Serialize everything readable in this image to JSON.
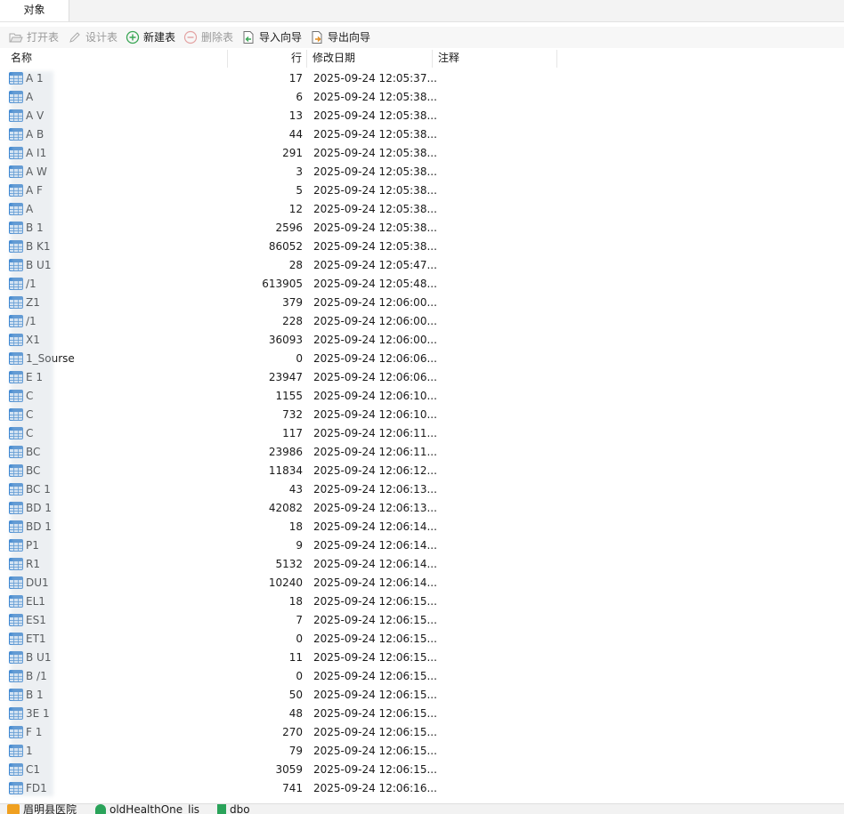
{
  "tabs": [
    {
      "label": "对象"
    }
  ],
  "toolbar": {
    "open_table": "打开表",
    "design_table": "设计表",
    "new_table": "新建表",
    "delete_table": "删除表",
    "import_wizard": "导入向导",
    "export_wizard": "导出向导"
  },
  "columns": {
    "name": "名称",
    "rows": "行",
    "modified": "修改日期",
    "comment": "注释"
  },
  "tables": [
    {
      "name": "A   1",
      "rows": "17",
      "modified": "2025-09-24 12:05:37..."
    },
    {
      "name": "A",
      "rows": "6",
      "modified": "2025-09-24 12:05:38..."
    },
    {
      "name": "A V",
      "rows": "13",
      "modified": "2025-09-24 12:05:38..."
    },
    {
      "name": "A B",
      "rows": "44",
      "modified": "2025-09-24 12:05:38..."
    },
    {
      "name": "A  I1",
      "rows": "291",
      "modified": "2025-09-24 12:05:38..."
    },
    {
      "name": "A W",
      "rows": "3",
      "modified": "2025-09-24 12:05:38..."
    },
    {
      "name": "A F",
      "rows": "5",
      "modified": "2025-09-24 12:05:38..."
    },
    {
      "name": "A",
      "rows": "12",
      "modified": "2025-09-24 12:05:38..."
    },
    {
      "name": "B   1",
      "rows": "2596",
      "modified": "2025-09-24 12:05:38..."
    },
    {
      "name": "B  K1",
      "rows": "86052",
      "modified": "2025-09-24 12:05:38..."
    },
    {
      "name": "B  U1",
      "rows": "28",
      "modified": "2025-09-24 12:05:47..."
    },
    {
      "name": "   /1",
      "rows": "613905",
      "modified": "2025-09-24 12:05:48..."
    },
    {
      "name": "   Z1",
      "rows": "379",
      "modified": "2025-09-24 12:06:00..."
    },
    {
      "name": "   /1",
      "rows": "228",
      "modified": "2025-09-24 12:06:00..."
    },
    {
      "name": "   X1",
      "rows": "36093",
      "modified": "2025-09-24 12:06:00..."
    },
    {
      "name": "    1_Sourse",
      "rows": "0",
      "modified": "2025-09-24 12:06:06..."
    },
    {
      "name": "  E 1",
      "rows": "23947",
      "modified": "2025-09-24 12:06:06..."
    },
    {
      "name": "  C",
      "rows": "1155",
      "modified": "2025-09-24 12:06:10..."
    },
    {
      "name": "  C",
      "rows": "732",
      "modified": "2025-09-24 12:06:10..."
    },
    {
      "name": "  C",
      "rows": "117",
      "modified": "2025-09-24 12:06:11..."
    },
    {
      "name": "  BC",
      "rows": "23986",
      "modified": "2025-09-24 12:06:11..."
    },
    {
      "name": "  BC",
      "rows": "11834",
      "modified": "2025-09-24 12:06:12..."
    },
    {
      "name": "  BC 1",
      "rows": "43",
      "modified": "2025-09-24 12:06:13..."
    },
    {
      "name": "  BD  1",
      "rows": "42082",
      "modified": "2025-09-24 12:06:13..."
    },
    {
      "name": "  BD  1",
      "rows": "18",
      "modified": "2025-09-24 12:06:14..."
    },
    {
      "name": "    P1",
      "rows": "9",
      "modified": "2025-09-24 12:06:14..."
    },
    {
      "name": "    R1",
      "rows": "5132",
      "modified": "2025-09-24 12:06:14..."
    },
    {
      "name": "   DU1",
      "rows": "10240",
      "modified": "2025-09-24 12:06:14..."
    },
    {
      "name": "   EL1",
      "rows": "18",
      "modified": "2025-09-24 12:06:15..."
    },
    {
      "name": "   ES1",
      "rows": "7",
      "modified": "2025-09-24 12:06:15..."
    },
    {
      "name": "   ET1",
      "rows": "0",
      "modified": "2025-09-24 12:06:15..."
    },
    {
      "name": "  B  U1",
      "rows": "11",
      "modified": "2025-09-24 12:06:15..."
    },
    {
      "name": "  B  /1",
      "rows": "0",
      "modified": "2025-09-24 12:06:15..."
    },
    {
      "name": "  B  1",
      "rows": "50",
      "modified": "2025-09-24 12:06:15..."
    },
    {
      "name": "  3E 1",
      "rows": "48",
      "modified": "2025-09-24 12:06:15..."
    },
    {
      "name": "    F 1",
      "rows": "270",
      "modified": "2025-09-24 12:06:15..."
    },
    {
      "name": "     1",
      "rows": "79",
      "modified": "2025-09-24 12:06:15..."
    },
    {
      "name": "    C1",
      "rows": "3059",
      "modified": "2025-09-24 12:06:15..."
    },
    {
      "name": "    FD1",
      "rows": "741",
      "modified": "2025-09-24 12:06:16..."
    }
  ],
  "statusbar": {
    "connection": "眉明县医院",
    "database": "oldHealthOne_lis",
    "schema": "dbo"
  },
  "colors": {
    "table_icon_blue": "#2f7fd0",
    "table_icon_light": "#d7e9fb",
    "new_icon_green": "#3aa655",
    "import_orange": "#e08a1e"
  }
}
